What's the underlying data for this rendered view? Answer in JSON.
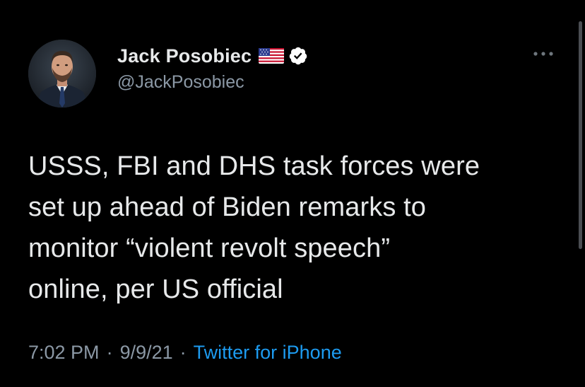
{
  "author": {
    "display_name": "Jack Posobiec",
    "handle": "@JackPosobiec",
    "avatar": "profile-photo",
    "badges": [
      "us-flag-icon",
      "verified-icon"
    ]
  },
  "tweet": {
    "text": "USSS, FBI and DHS task forces were\nset up ahead of Biden remarks to\nmonitor “violent revolt speech”\nonline, per US official",
    "time": "7:02 PM",
    "date": "9/9/21",
    "separator": "·",
    "source": "Twitter for iPhone"
  },
  "menu": {
    "icon": "more-horizontal-icon"
  },
  "colors": {
    "background": "#000000",
    "primary_text": "#e7e9ea",
    "secondary_text": "#8b98a5",
    "link": "#1d9bf0"
  }
}
